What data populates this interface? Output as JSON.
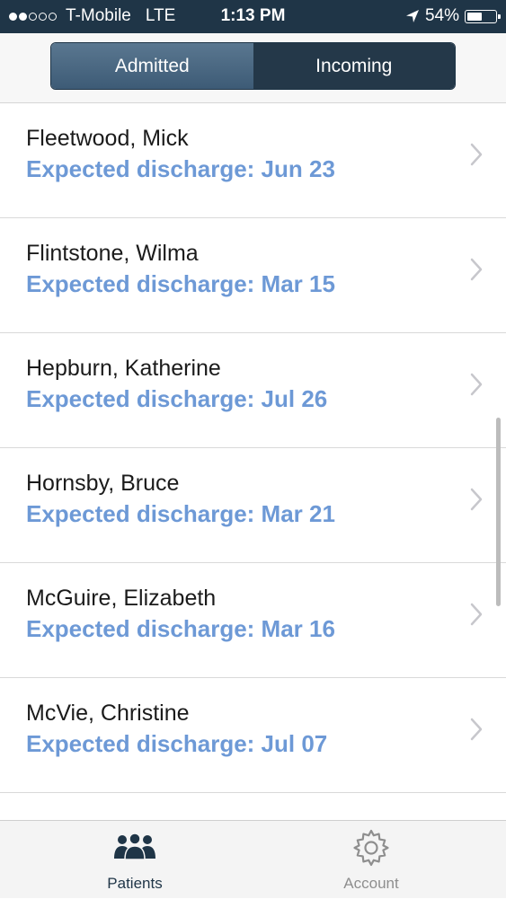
{
  "status_bar": {
    "carrier": "T-Mobile",
    "network": "LTE",
    "time": "1:13 PM",
    "battery_text": "54%",
    "battery_level": 0.54,
    "signal_bars_filled": 2,
    "signal_bars_total": 5
  },
  "segmented": {
    "tabs": [
      {
        "label": "Admitted",
        "selected": true
      },
      {
        "label": "Incoming",
        "selected": false
      }
    ]
  },
  "patients": [
    {
      "name": "Fleetwood, Mick",
      "discharge": "Expected discharge: Jun 23"
    },
    {
      "name": "Flintstone, Wilma",
      "discharge": "Expected discharge: Mar 15"
    },
    {
      "name": "Hepburn, Katherine",
      "discharge": "Expected discharge: Jul 26"
    },
    {
      "name": "Hornsby, Bruce",
      "discharge": "Expected discharge: Mar 21"
    },
    {
      "name": "McGuire, Elizabeth",
      "discharge": "Expected discharge: Mar 16"
    },
    {
      "name": "McVie, Christine",
      "discharge": "Expected discharge: Jul 07"
    }
  ],
  "tab_bar": {
    "items": [
      {
        "label": "Patients",
        "icon": "people-icon",
        "selected": true
      },
      {
        "label": "Account",
        "icon": "gear-icon",
        "selected": false
      }
    ]
  },
  "colors": {
    "navy": "#1f3547",
    "accent_blue": "#6d99d6",
    "segment_selected": "#4a6782"
  }
}
